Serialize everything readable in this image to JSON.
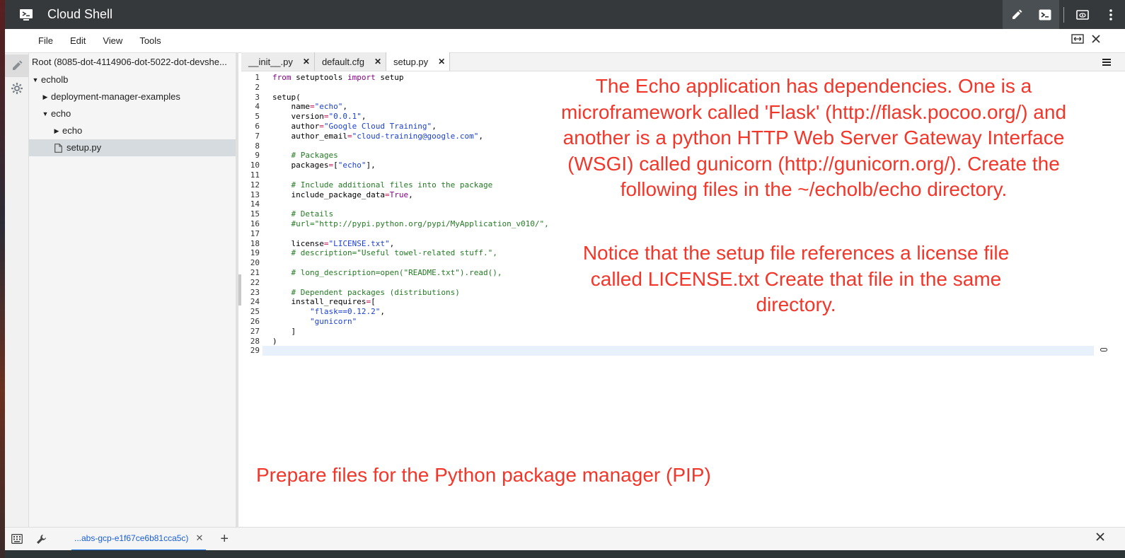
{
  "titlebar": {
    "title": "Cloud Shell"
  },
  "menu": {
    "items": [
      "File",
      "Edit",
      "View",
      "Tools"
    ]
  },
  "tree": {
    "root": "Root (8085-dot-4114906-dot-5022-dot-devshe...",
    "nodes": [
      {
        "label": "echolb",
        "arrow": "▼"
      },
      {
        "label": "deployment-manager-examples",
        "arrow": "▶"
      },
      {
        "label": "echo",
        "arrow": "▼"
      },
      {
        "label": "echo",
        "arrow": "▶"
      },
      {
        "label": "setup.py"
      }
    ]
  },
  "editor": {
    "tabs": [
      {
        "label": "__init__.py",
        "close": "✕"
      },
      {
        "label": "default.cfg",
        "close": "✕"
      },
      {
        "label": "setup.py",
        "close": "✕"
      }
    ],
    "line_numbers": [
      "1",
      "2",
      "3",
      "4",
      "5",
      "6",
      "7",
      "8",
      "9",
      "10",
      "11",
      "12",
      "13",
      "14",
      "15",
      "16",
      "17",
      "18",
      "19",
      "20",
      "21",
      "22",
      "23",
      "24",
      "25",
      "26",
      "27",
      "28",
      "29"
    ]
  },
  "annotations": {
    "text1": "The Echo application has dependencies. One is a microframework called 'Flask' (http://flask.pocoo.org/) and another is a python HTTP Web Server Gateway Interface (WSGI) called gunicorn (http://gunicorn.org/). Create the following files in the ~/echolb/echo directory.",
    "text2": "Notice that the setup file references a license file called LICENSE.txt Create that file in the same directory.",
    "text3": "Prepare files for the Python package manager (PIP)"
  },
  "terminal": {
    "tab_label": "...abs-gcp-e1f67ce6b81cca5c)",
    "tab_close": "✕",
    "add": "+"
  },
  "colors": {
    "titlebar": "#35393c",
    "annotation": "#f2362a",
    "string": "#1a3fd4",
    "comment": "#237a23",
    "keyword": "#8b008b"
  }
}
